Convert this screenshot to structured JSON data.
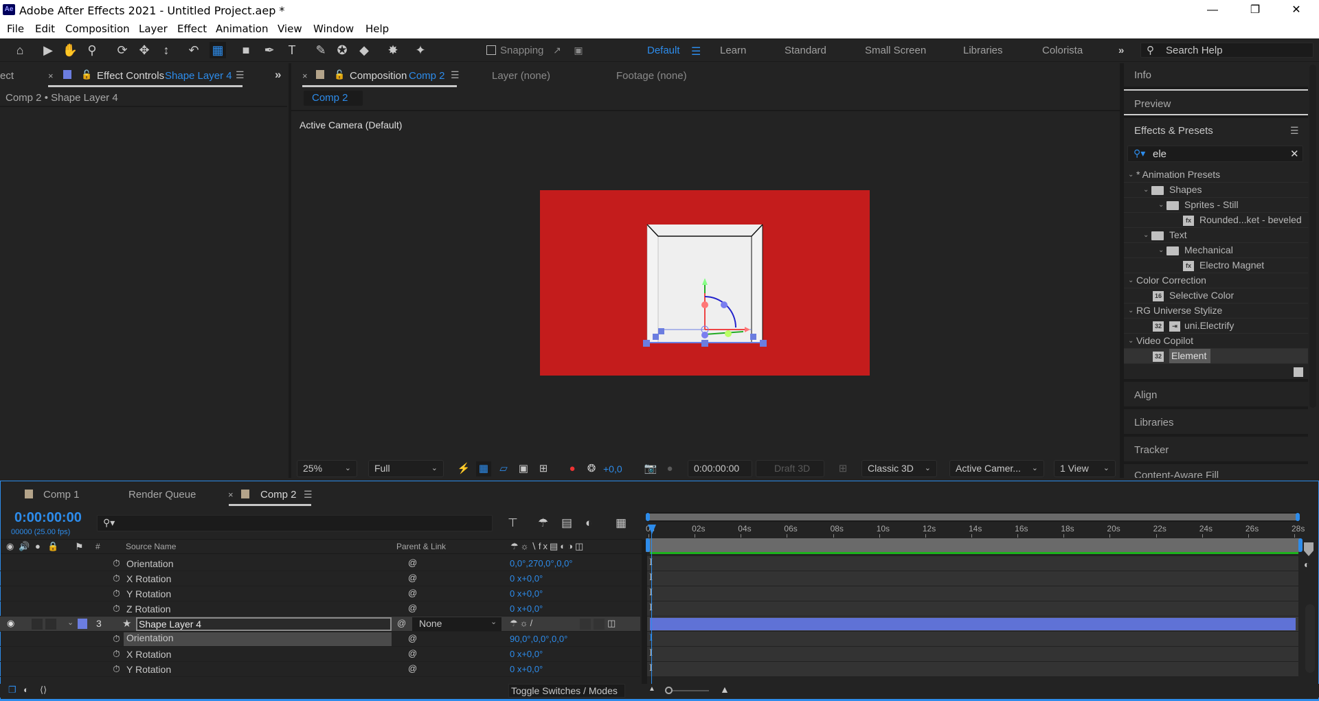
{
  "window": {
    "title": "Adobe After Effects 2021 - Untitled Project.aep *",
    "app_badge": "Ae",
    "controls": [
      "minimize-icon",
      "restore-icon",
      "close-icon"
    ]
  },
  "menu": [
    "File",
    "Edit",
    "Composition",
    "Layer",
    "Effect",
    "Animation",
    "View",
    "Window",
    "Help"
  ],
  "toolbar": {
    "tools": [
      "home",
      "selection",
      "hand",
      "zoom",
      "orbit-camera",
      "pan-camera",
      "dolly-camera",
      "rotation",
      "anchor-point",
      "rectangle",
      "pen",
      "type",
      "brush",
      "clone-stamp",
      "eraser",
      "roto-brush",
      "puppet-pin"
    ],
    "snapping_label": "Snapping",
    "workspaces": [
      "Default",
      "Learn",
      "Standard",
      "Small Screen",
      "Libraries",
      "Colorista"
    ],
    "active_workspace": "Default",
    "search_help_placeholder": "Search Help"
  },
  "left_panel": {
    "cut_tab": "ect",
    "tab_prefix": "Effect Controls",
    "tab_layer": "Shape Layer 4",
    "label_color": "#6b7de0",
    "breadcrumb": "Comp 2 • Shape Layer 4"
  },
  "viewer": {
    "tab_prefix": "Composition",
    "tab_comp": "Comp 2",
    "label_color": "#b4a48a",
    "layer_tab": "Layer (none)",
    "footage_tab": "Footage (none)",
    "comp_chip": "Comp 2",
    "camera_label": "Active Camera (Default)",
    "comp_bg_color": "#c41c1c",
    "footer": {
      "zoom": "25%",
      "resolution": "Full",
      "exposure": "+0,0",
      "timecode": "0:00:00:00",
      "draft3d": "Draft 3D",
      "renderer": "Classic 3D",
      "camera": "Active Camer...",
      "views": "1 View"
    }
  },
  "right_panel": {
    "info": "Info",
    "preview": "Preview",
    "effects_title": "Effects & Presets",
    "search_value": "ele",
    "tree": [
      {
        "label": "* Animation Presets",
        "level": 0,
        "type": "category"
      },
      {
        "label": "Shapes",
        "level": 1,
        "type": "folder"
      },
      {
        "label": "Sprites - Still",
        "level": 2,
        "type": "folder"
      },
      {
        "label": "Rounded...ket - beveled",
        "level": 3,
        "type": "preset",
        "badge": "fx"
      },
      {
        "label": "Text",
        "level": 1,
        "type": "folder"
      },
      {
        "label": "Mechanical",
        "level": 2,
        "type": "folder"
      },
      {
        "label": "Electro Magnet",
        "level": 3,
        "type": "preset",
        "badge": "fx"
      },
      {
        "label": "Color Correction",
        "level": 0,
        "type": "category"
      },
      {
        "label": "Selective Color",
        "level": 1,
        "type": "effect",
        "badge": "16"
      },
      {
        "label": "RG Universe Stylize",
        "level": 0,
        "type": "category"
      },
      {
        "label": "uni.Electrify",
        "level": 1,
        "type": "effect",
        "badge": "32"
      },
      {
        "label": "Video Copilot",
        "level": 0,
        "type": "category"
      },
      {
        "label": "Element",
        "level": 1,
        "type": "effect",
        "badge": "32",
        "selected": true
      }
    ],
    "align": "Align",
    "libraries": "Libraries",
    "tracker": "Tracker",
    "content_aware_fill": "Content-Aware Fill"
  },
  "timeline": {
    "tabs": [
      {
        "label": "Comp 1",
        "color": "#b4a48a"
      },
      {
        "label": "Render Queue"
      },
      {
        "label": "Comp 2",
        "color": "#b4a48a",
        "active": true
      }
    ],
    "timecode": "0:00:00:00",
    "frame_info": "00000 (25.00 fps)",
    "search_placeholder": "",
    "col_num": "#",
    "col_source": "Source Name",
    "col_parent": "Parent & Link",
    "rows": [
      {
        "type": "prop",
        "name": "Orientation",
        "value": "0,0°,270,0°,0,0°"
      },
      {
        "type": "prop",
        "name": "X Rotation",
        "value": "0 x+0,0°"
      },
      {
        "type": "prop",
        "name": "Y Rotation",
        "value": "0 x+0,0°"
      },
      {
        "type": "prop",
        "name": "Z Rotation",
        "value": "0 x+0,0°"
      },
      {
        "type": "layer",
        "num": "3",
        "name": "Shape Layer 4",
        "parent": "None",
        "color": "#6b7de0"
      },
      {
        "type": "prop",
        "name": "Orientation",
        "value": "90,0°,0,0°,0,0°",
        "selected": true
      },
      {
        "type": "prop",
        "name": "X Rotation",
        "value": "0 x+0,0°"
      },
      {
        "type": "prop",
        "name": "Y Rotation",
        "value": "0 x+0,0°"
      }
    ],
    "ruler": [
      "0s",
      "02s",
      "04s",
      "06s",
      "08s",
      "10s",
      "12s",
      "14s",
      "16s",
      "18s",
      "20s",
      "22s",
      "24s",
      "26s",
      "28s"
    ],
    "toggle_label": "Toggle Switches / Modes",
    "work_area_color": "#1db21d",
    "layer_bar_color": "#5f72d6"
  }
}
